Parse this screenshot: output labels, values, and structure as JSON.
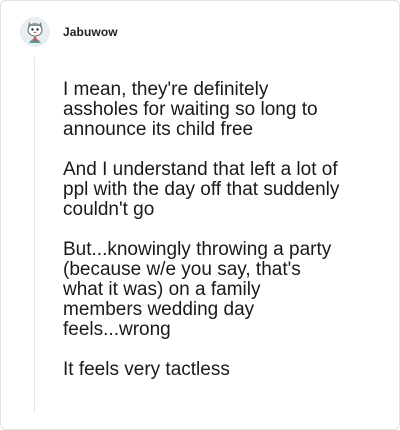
{
  "comment": {
    "username": "Jabuwow",
    "avatar_icon": "cartoon-avatar-icon",
    "paragraphs": [
      "I mean, they're definitely\nassholes for waiting so long to\nannounce its child free",
      "And I understand that left a lot of\nppl with the day off that suddenly\ncouldn't go",
      "But...knowingly throwing a party\n(because w/e you say, that's\nwhat it was) on a family\nmembers wedding day\nfeels...wrong",
      "It feels very tactless"
    ]
  }
}
